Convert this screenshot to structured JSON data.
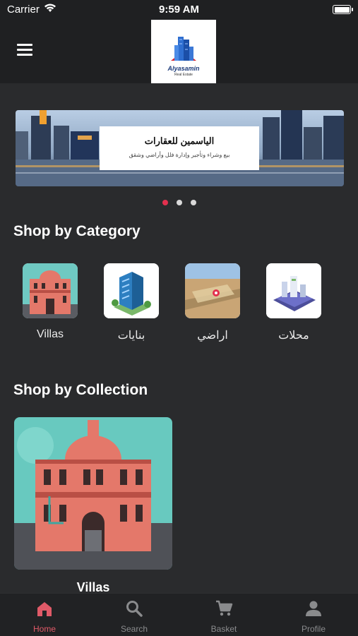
{
  "status_bar": {
    "carrier": "Carrier",
    "time": "9:59 AM"
  },
  "header": {
    "logo_text": "Alyasamin",
    "logo_subtext": "Real Estate"
  },
  "banner": {
    "title": "الياسمين للعقارات",
    "subtitle": "بيع وشراء وتأجير وإدارة فلل وأراضي وشقق",
    "pages": 3,
    "active_page": 1
  },
  "categories": {
    "title": "Shop by Category",
    "items": [
      {
        "label": "Villas",
        "icon": "villa-building-icon"
      },
      {
        "label": "بنايات",
        "icon": "office-building-icon"
      },
      {
        "label": "اراضي",
        "icon": "land-map-icon"
      },
      {
        "label": "محلات",
        "icon": "shops-isometric-icon"
      }
    ]
  },
  "collections": {
    "title": "Shop by Collection",
    "items": [
      {
        "label": "Villas",
        "icon": "villa-building-icon"
      }
    ]
  },
  "tabbar": {
    "items": [
      {
        "label": "Home",
        "icon": "home-icon",
        "active": true
      },
      {
        "label": "Search",
        "icon": "search-icon",
        "active": false
      },
      {
        "label": "Basket",
        "icon": "cart-icon",
        "active": false
      },
      {
        "label": "Profile",
        "icon": "person-icon",
        "active": false
      }
    ]
  },
  "colors": {
    "background": "#2a2b2d",
    "bar": "#1f2022",
    "accent": "#e3304e",
    "inactive": "#8a8b8d"
  }
}
